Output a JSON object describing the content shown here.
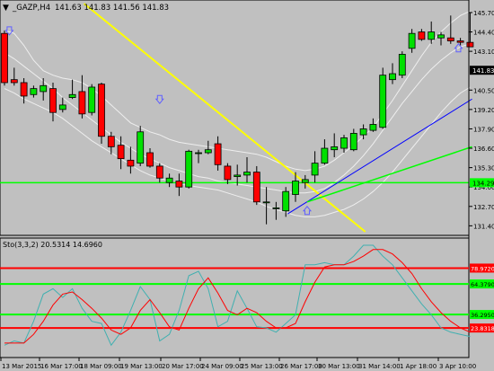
{
  "header": {
    "symbol": "_GAZP,H4",
    "ohlc": "141.63 141.83 141.56 141.83",
    "menu_arrow": "▼"
  },
  "oscillator_label": "Sto(3,3,2) 20.5314 14.6960",
  "price_axis": {
    "ticks": [
      "145.70",
      "144.40",
      "143.10",
      "141.83",
      "140.50",
      "139.20",
      "137.90",
      "136.60",
      "135.30",
      "134.00",
      "132.70",
      "131.40"
    ],
    "current_price": "141.83",
    "hline_label": "134.29"
  },
  "osc_axis": {
    "levels": [
      "78.9720",
      "64.3790",
      "36.2950",
      "23.8318"
    ]
  },
  "time_axis": [
    "13 Mar 2015",
    "16 Mar 17:00",
    "18 Mar 09:00",
    "19 Mar 13:00",
    "20 Mar 17:00",
    "24 Mar 09:00",
    "25 Mar 13:00",
    "26 Mar 17:00",
    "30 Mar 13:00",
    "31 Mar 14:00",
    "1 Apr 18:00",
    "3 Apr 10:00"
  ],
  "colors": {
    "background": "#c0c0c0",
    "bull": "#00e000",
    "bear": "#ff0000",
    "ma": "#eeeeee",
    "yellow_line": "#ffff00",
    "blue_line": "#0000ff",
    "green_line": "#00ff00",
    "osc_k": "#40b0b0",
    "osc_d": "#ff0000",
    "arrow": "#6060ff"
  },
  "chart_data": {
    "type": "candlestick",
    "candles": [
      {
        "o": 144.3,
        "h": 144.5,
        "l": 140.8,
        "c": 141.0
      },
      {
        "o": 141.2,
        "h": 142.0,
        "l": 140.8,
        "c": 141.0
      },
      {
        "o": 141.0,
        "h": 141.3,
        "l": 139.6,
        "c": 140.1
      },
      {
        "o": 140.2,
        "h": 140.8,
        "l": 140.0,
        "c": 140.6
      },
      {
        "o": 140.4,
        "h": 141.3,
        "l": 139.8,
        "c": 140.8
      },
      {
        "o": 140.6,
        "h": 141.0,
        "l": 138.4,
        "c": 139.0
      },
      {
        "o": 139.2,
        "h": 140.0,
        "l": 139.0,
        "c": 139.5
      },
      {
        "o": 140.0,
        "h": 141.2,
        "l": 139.9,
        "c": 140.2
      },
      {
        "o": 140.4,
        "h": 141.5,
        "l": 138.6,
        "c": 138.9
      },
      {
        "o": 139.0,
        "h": 140.9,
        "l": 138.8,
        "c": 140.7
      },
      {
        "o": 140.9,
        "h": 141.0,
        "l": 136.9,
        "c": 137.4
      },
      {
        "o": 137.4,
        "h": 137.7,
        "l": 136.2,
        "c": 136.7
      },
      {
        "o": 136.8,
        "h": 137.4,
        "l": 135.2,
        "c": 135.9
      },
      {
        "o": 135.8,
        "h": 136.7,
        "l": 134.9,
        "c": 135.4
      },
      {
        "o": 135.6,
        "h": 138.1,
        "l": 135.4,
        "c": 137.7
      },
      {
        "o": 136.3,
        "h": 136.6,
        "l": 135.3,
        "c": 135.4
      },
      {
        "o": 135.4,
        "h": 135.6,
        "l": 134.3,
        "c": 134.6
      },
      {
        "o": 134.3,
        "h": 134.9,
        "l": 134.0,
        "c": 134.6
      },
      {
        "o": 134.4,
        "h": 134.9,
        "l": 133.4,
        "c": 134.0
      },
      {
        "o": 134.0,
        "h": 136.5,
        "l": 133.9,
        "c": 136.4
      },
      {
        "o": 136.3,
        "h": 136.5,
        "l": 135.6,
        "c": 136.3
      },
      {
        "o": 136.3,
        "h": 137.1,
        "l": 136.2,
        "c": 136.5
      },
      {
        "o": 136.9,
        "h": 137.4,
        "l": 135.1,
        "c": 135.5
      },
      {
        "o": 135.4,
        "h": 135.6,
        "l": 134.2,
        "c": 134.5
      },
      {
        "o": 134.7,
        "h": 135.5,
        "l": 134.1,
        "c": 134.8
      },
      {
        "o": 134.8,
        "h": 136.0,
        "l": 134.3,
        "c": 135.0
      },
      {
        "o": 135.0,
        "h": 135.4,
        "l": 132.8,
        "c": 133.0
      },
      {
        "o": 133.0,
        "h": 134.0,
        "l": 131.5,
        "c": 133.0
      },
      {
        "o": 132.6,
        "h": 133.0,
        "l": 131.8,
        "c": 132.6
      },
      {
        "o": 132.4,
        "h": 134.0,
        "l": 132.0,
        "c": 133.7
      },
      {
        "o": 133.5,
        "h": 135.0,
        "l": 133.0,
        "c": 134.4
      },
      {
        "o": 134.3,
        "h": 134.8,
        "l": 133.9,
        "c": 134.5
      },
      {
        "o": 134.8,
        "h": 136.4,
        "l": 134.3,
        "c": 135.6
      },
      {
        "o": 135.6,
        "h": 137.2,
        "l": 135.5,
        "c": 136.6
      },
      {
        "o": 136.5,
        "h": 137.6,
        "l": 136.0,
        "c": 136.7
      },
      {
        "o": 136.6,
        "h": 137.5,
        "l": 136.3,
        "c": 137.3
      },
      {
        "o": 136.5,
        "h": 137.9,
        "l": 136.4,
        "c": 137.6
      },
      {
        "o": 137.5,
        "h": 138.2,
        "l": 137.2,
        "c": 137.9
      },
      {
        "o": 137.8,
        "h": 138.6,
        "l": 137.7,
        "c": 138.2
      },
      {
        "o": 138.0,
        "h": 142.0,
        "l": 137.9,
        "c": 141.5
      },
      {
        "o": 141.2,
        "h": 142.3,
        "l": 140.9,
        "c": 141.6
      },
      {
        "o": 141.5,
        "h": 143.1,
        "l": 141.3,
        "c": 142.9
      },
      {
        "o": 143.3,
        "h": 144.6,
        "l": 143.0,
        "c": 144.3
      },
      {
        "o": 144.4,
        "h": 144.6,
        "l": 143.8,
        "c": 143.9
      },
      {
        "o": 143.9,
        "h": 145.1,
        "l": 143.6,
        "c": 144.4
      },
      {
        "o": 144.0,
        "h": 144.4,
        "l": 143.5,
        "c": 144.2
      },
      {
        "o": 144.0,
        "h": 145.5,
        "l": 143.6,
        "c": 143.8
      },
      {
        "o": 143.8,
        "h": 144.0,
        "l": 143.5,
        "c": 143.7
      },
      {
        "o": 143.7,
        "h": 145.7,
        "l": 143.4,
        "c": 143.4
      }
    ],
    "ma_upper": [
      144.5,
      144.3,
      143.5,
      142.5,
      141.8,
      141.5,
      141.3,
      141.2,
      141.0,
      140.6,
      140.1,
      139.5,
      138.9,
      138.3,
      138.0,
      137.7,
      137.5,
      137.2,
      137.0,
      136.9,
      136.8,
      136.7,
      136.6,
      136.5,
      136.4,
      136.3,
      136.2,
      136.0,
      135.7,
      135.4,
      135.2,
      135.1,
      135.2,
      135.4,
      135.8,
      136.3,
      136.8,
      137.4,
      138.0,
      138.9,
      139.8,
      140.8,
      141.8,
      142.8,
      143.7,
      144.4,
      145.0,
      145.5,
      145.8
    ],
    "ma_lower": [
      140.6,
      140.3,
      139.9,
      139.6,
      139.3,
      139.0,
      138.6,
      138.1,
      137.6,
      137.1,
      136.7,
      136.3,
      135.9,
      135.5,
      135.1,
      134.8,
      134.6,
      134.4,
      134.2,
      134.1,
      134.0,
      133.9,
      133.8,
      133.6,
      133.4,
      133.2,
      133.0,
      132.7,
      132.5,
      132.3,
      132.1,
      132.0,
      132.0,
      132.1,
      132.3,
      132.5,
      132.8,
      133.2,
      133.7,
      134.3,
      135.0,
      135.8,
      136.6,
      137.4,
      138.2,
      139.0,
      139.7,
      140.3,
      140.7
    ],
    "ma_mid": [
      143.0,
      142.6,
      142.1,
      141.6,
      141.1,
      140.6,
      140.0,
      139.5,
      139.0,
      138.5,
      138.0,
      137.5,
      137.0,
      136.6,
      136.2,
      135.9,
      135.6,
      135.3,
      135.1,
      134.9,
      134.7,
      134.6,
      134.4,
      134.3,
      134.2,
      134.1,
      134.0,
      133.9,
      133.8,
      133.7,
      133.6,
      133.6,
      133.7,
      133.9,
      134.3,
      134.8,
      135.4,
      136.1,
      136.9,
      137.8,
      138.7,
      139.6,
      140.4,
      141.2,
      141.9,
      142.5,
      143.0,
      143.4,
      143.6
    ],
    "stoch_k": [
      8,
      12,
      10,
      30,
      55,
      60,
      52,
      60,
      42,
      30,
      28,
      8,
      20,
      40,
      62,
      50,
      12,
      18,
      40,
      72,
      76,
      60,
      25,
      30,
      58,
      42,
      25,
      24,
      20,
      28,
      36,
      82,
      82,
      84,
      82,
      82,
      90,
      100,
      100,
      90,
      82,
      70,
      58,
      46,
      36,
      24,
      20,
      18,
      16
    ],
    "stoch_d": [
      10,
      10,
      10,
      18,
      30,
      45,
      55,
      57,
      50,
      42,
      33,
      22,
      18,
      24,
      40,
      50,
      38,
      25,
      22,
      42,
      60,
      70,
      56,
      40,
      36,
      42,
      38,
      30,
      24,
      24,
      28,
      48,
      66,
      80,
      82,
      82,
      85,
      90,
      96,
      96,
      92,
      84,
      74,
      60,
      48,
      38,
      30,
      24,
      20
    ],
    "price_range": [
      131.0,
      146.3
    ],
    "osc_range": [
      0,
      100
    ]
  }
}
